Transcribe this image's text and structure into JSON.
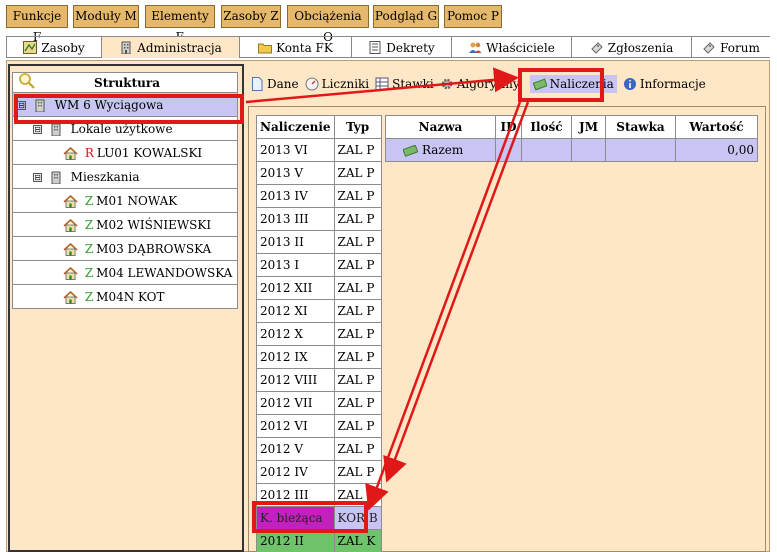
{
  "menu": [
    {
      "label": "Funkcje F"
    },
    {
      "label": "Moduły M"
    },
    {
      "label": "Elementy E"
    },
    {
      "label": "Zasoby Z"
    },
    {
      "label": "Obciążenia O"
    },
    {
      "label": "Podgląd G"
    },
    {
      "label": "Pomoc P"
    }
  ],
  "tabs": [
    {
      "label": "Zasoby",
      "icon": "map-icon"
    },
    {
      "label": "Administracja",
      "icon": "building-icon",
      "active": true
    },
    {
      "label": "Konta FK",
      "icon": "folder-icon"
    },
    {
      "label": "Dekrety",
      "icon": "document-list-icon"
    },
    {
      "label": "Właściciele",
      "icon": "people-icon"
    },
    {
      "label": "Zgłoszenia",
      "icon": "ticket-icon"
    },
    {
      "label": "Forum",
      "icon": "ticket-icon"
    }
  ],
  "tree": {
    "header": "Struktura",
    "root": {
      "label": "WM 6 Wyciągowa",
      "expander": "⊟"
    },
    "groups": [
      {
        "label": "Lokale użytkowe",
        "expander": "⊟",
        "items": [
          {
            "prefix": "R",
            "label": "LU01 KOWALSKI"
          }
        ]
      },
      {
        "label": "Mieszkania",
        "expander": "⊟",
        "items": [
          {
            "prefix": "Z",
            "label": "M01 NOWAK"
          },
          {
            "prefix": "Z",
            "label": "M02 WIŚNIEWSKI"
          },
          {
            "prefix": "Z",
            "label": "M03 DĄBROWSKA"
          },
          {
            "prefix": "Z",
            "label": "M04 LEWANDOWSKA"
          },
          {
            "prefix": "Z",
            "label": "M04N KOT"
          }
        ]
      }
    ]
  },
  "subtabs": [
    {
      "label": "Dane"
    },
    {
      "label": "Liczniki"
    },
    {
      "label": "Stawki"
    },
    {
      "label": "Algorytmy"
    },
    {
      "label": "Naliczenia",
      "active": true
    },
    {
      "label": "Informacje"
    }
  ],
  "naliczenia": {
    "columns": [
      "Naliczenie",
      "Typ"
    ],
    "rows": [
      {
        "naliczenie": "2013 VI",
        "typ": "ZAL P"
      },
      {
        "naliczenie": "2013 V",
        "typ": "ZAL P"
      },
      {
        "naliczenie": "2013 IV",
        "typ": "ZAL P"
      },
      {
        "naliczenie": "2013 III",
        "typ": "ZAL P"
      },
      {
        "naliczenie": "2013 II",
        "typ": "ZAL P"
      },
      {
        "naliczenie": "2013 I",
        "typ": "ZAL P"
      },
      {
        "naliczenie": "2012 XII",
        "typ": "ZAL P"
      },
      {
        "naliczenie": "2012 XI",
        "typ": "ZAL P"
      },
      {
        "naliczenie": "2012 X",
        "typ": "ZAL P"
      },
      {
        "naliczenie": "2012 IX",
        "typ": "ZAL P"
      },
      {
        "naliczenie": "2012 VIII",
        "typ": "ZAL P"
      },
      {
        "naliczenie": "2012 VII",
        "typ": "ZAL P"
      },
      {
        "naliczenie": "2012 VI",
        "typ": "ZAL P"
      },
      {
        "naliczenie": "2012 V",
        "typ": "ZAL P"
      },
      {
        "naliczenie": "2012 IV",
        "typ": "ZAL P"
      },
      {
        "naliczenie": "2012 III",
        "typ": "ZAL P"
      },
      {
        "naliczenie": "K. bieżąca",
        "typ": "KOR B",
        "style": "current"
      },
      {
        "naliczenie": "2012 II",
        "typ": "ZAL K",
        "style": "green"
      }
    ]
  },
  "detail": {
    "columns": [
      "Nazwa",
      "ID",
      "Ilość",
      "JM",
      "Stawka",
      "Wartość"
    ],
    "total_row": {
      "nazwa": "Razem",
      "wartosc": "0,00"
    }
  },
  "colors": {
    "panel_bg": "#fde7c6",
    "menu_btn": "#e6b86b",
    "selection": "#c8c4f4",
    "current_row": "#c41fbf",
    "green_row": "#6fc36b",
    "annotation_red": "#e01818"
  }
}
